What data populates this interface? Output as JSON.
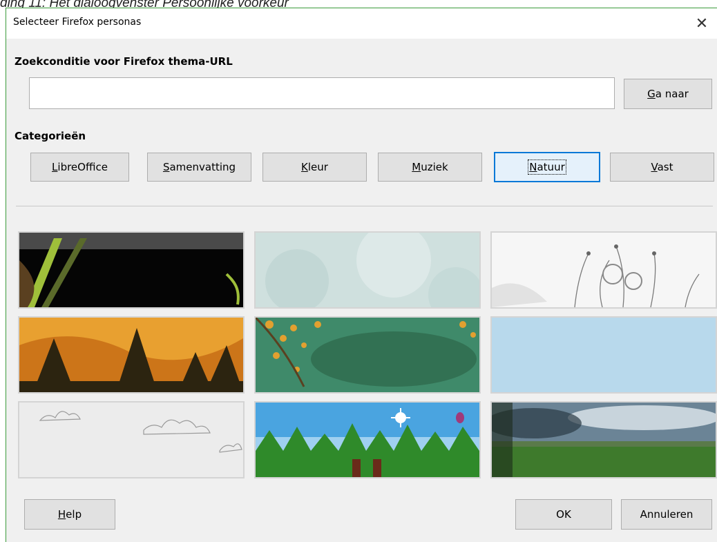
{
  "caption": "ding 11: Het dialoogvenster Persoonlijke voorkeur",
  "dialog": {
    "title": "Selecteer Firefox personas",
    "close_glyph": "✕"
  },
  "search": {
    "label": "Zoekconditie voor Firefox thema-URL",
    "value": "",
    "go_accel": "G",
    "go_rest": "a naar"
  },
  "categories": {
    "label": "Categorieën",
    "selected": "Natuur",
    "items": [
      {
        "accel": "L",
        "rest": "ibreOffice"
      },
      {
        "accel": "S",
        "rest": "amenvatting"
      },
      {
        "accel": "K",
        "rest": "leur"
      },
      {
        "accel": "M",
        "rest": "uziek"
      },
      {
        "accel": "N",
        "rest": "atuur"
      },
      {
        "accel": "V",
        "rest": "ast"
      }
    ]
  },
  "themes": [
    {
      "name": "dark-bamboo",
      "colors": [
        "#4a4a4a",
        "#050505",
        "#9fbf3a"
      ]
    },
    {
      "name": "pale-mint",
      "colors": [
        "#cfe0de",
        "#bcd3d1",
        "#e6efee"
      ]
    },
    {
      "name": "white-flowers",
      "colors": [
        "#f6f6f6",
        "#e2e2e2",
        "#7a7a7a"
      ]
    },
    {
      "name": "orange-forest",
      "colors": [
        "#e8a030",
        "#c46a14",
        "#2c2410"
      ]
    },
    {
      "name": "green-leaves",
      "colors": [
        "#3f8a6a",
        "#2f6a4e",
        "#e2a030"
      ]
    },
    {
      "name": "light-blue",
      "colors": [
        "#b8d9ec",
        "#b8d9ec",
        "#b8d9ec"
      ]
    },
    {
      "name": "cloud-sketch",
      "colors": [
        "#ececec",
        "#e0e0e0",
        "#9a9a9a"
      ]
    },
    {
      "name": "sunny-trees",
      "colors": [
        "#4aa4e0",
        "#2f8a2a",
        "#9fd0f0"
      ]
    },
    {
      "name": "green-field",
      "colors": [
        "#6b8496",
        "#3e7a2c",
        "#1c2a1a"
      ]
    }
  ],
  "footer": {
    "help_accel": "H",
    "help_rest": "elp",
    "ok_label": "OK",
    "cancel_label": "Annuleren"
  }
}
